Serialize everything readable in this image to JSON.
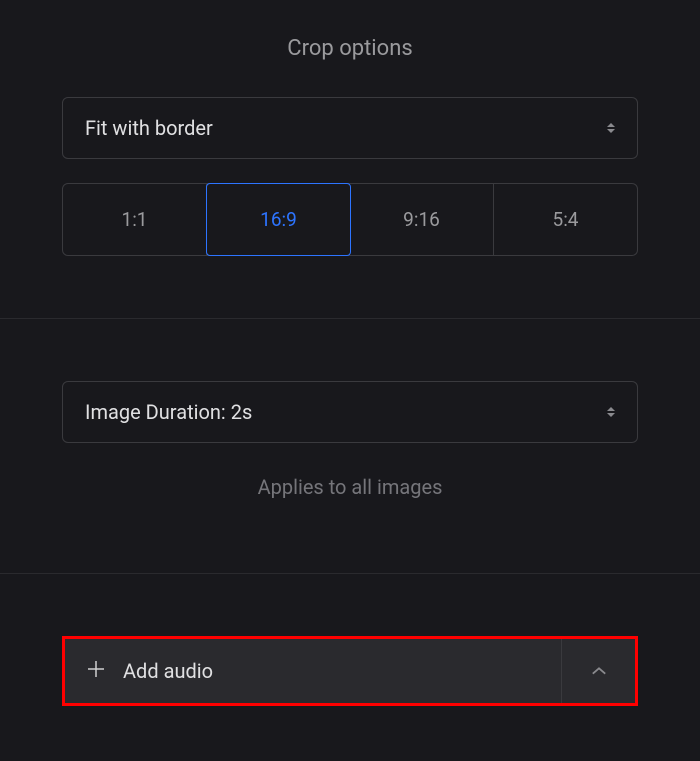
{
  "crop": {
    "title": "Crop options",
    "fit_label": "Fit with border",
    "ratios": {
      "r0": "1:1",
      "r1": "16:9",
      "r2": "9:16",
      "r3": "5:4"
    }
  },
  "duration": {
    "label": "Image Duration: 2s",
    "hint": "Applies to all images"
  },
  "audio": {
    "add_label": "Add audio"
  }
}
